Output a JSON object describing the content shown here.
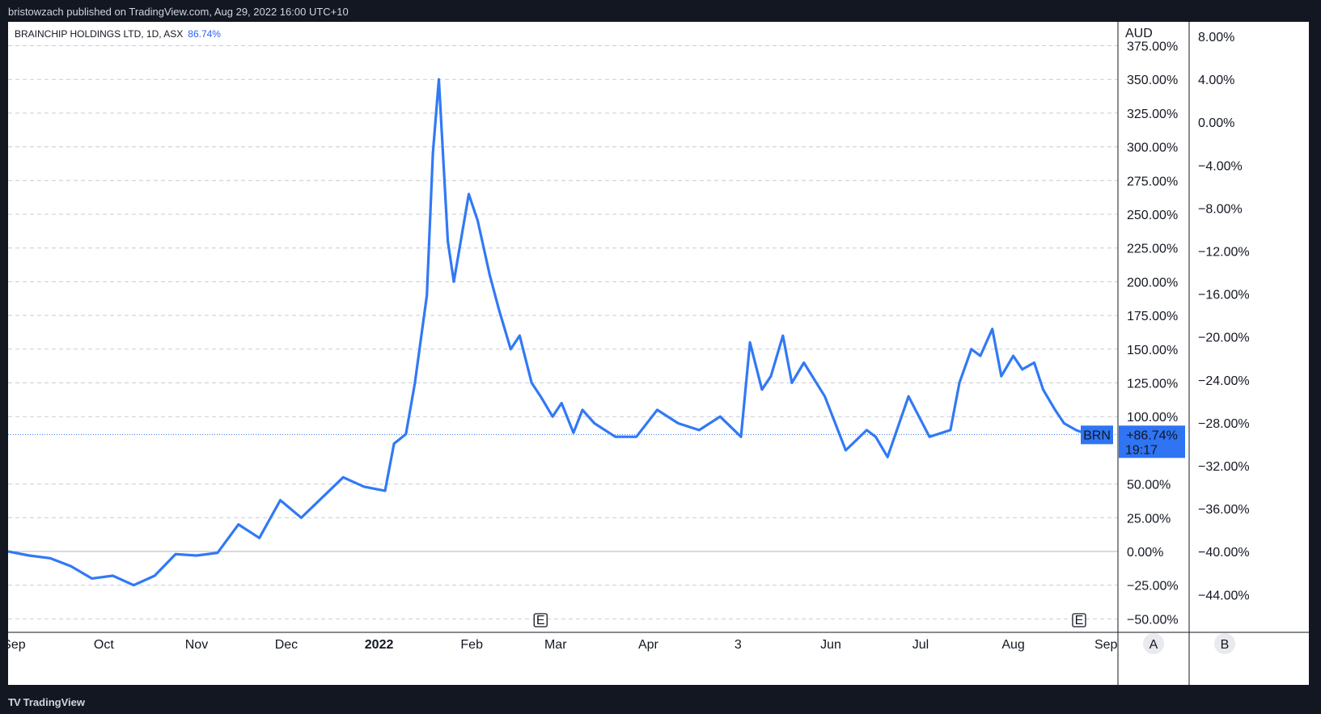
{
  "header": {
    "published_by": "bristowzach published on TradingView.com, Aug 29, 2022 16:00 UTC+10"
  },
  "legend": {
    "symbol_line": "BRAINCHIP HOLDINGS LTD, 1D, ASX",
    "change": "86.74%"
  },
  "scales": {
    "currency": "AUD"
  },
  "price_tag": {
    "symbol": "BRN",
    "value": "+86.74%",
    "countdown": "19:17"
  },
  "earnings_marker": {
    "label": "E"
  },
  "scale_buttons": [
    "A",
    "B"
  ],
  "footer": {
    "brand": "TradingView",
    "logo": "TV"
  },
  "colors": {
    "series": "#3179f5",
    "tag_bg": "#2f74f2",
    "grid": "#c9ccd3",
    "zero_line": "#b2b5be",
    "background": "#ffffff",
    "frame": "#131722"
  },
  "chart_data": {
    "type": "line",
    "series": [
      {
        "name": "BRN",
        "dates": [
          "2021-08-30",
          "2021-09-06",
          "2021-09-13",
          "2021-09-20",
          "2021-09-27",
          "2021-10-04",
          "2021-10-11",
          "2021-10-18",
          "2021-10-25",
          "2021-11-01",
          "2021-11-08",
          "2021-11-15",
          "2021-11-22",
          "2021-11-29",
          "2021-12-06",
          "2021-12-13",
          "2021-12-20",
          "2021-12-27",
          "2022-01-03",
          "2022-01-06",
          "2022-01-10",
          "2022-01-13",
          "2022-01-17",
          "2022-01-19",
          "2022-01-21",
          "2022-01-24",
          "2022-01-26",
          "2022-01-31",
          "2022-02-03",
          "2022-02-07",
          "2022-02-10",
          "2022-02-14",
          "2022-02-17",
          "2022-02-21",
          "2022-02-24",
          "2022-02-28",
          "2022-03-03",
          "2022-03-07",
          "2022-03-10",
          "2022-03-14",
          "2022-03-21",
          "2022-03-28",
          "2022-04-04",
          "2022-04-11",
          "2022-04-18",
          "2022-04-25",
          "2022-05-02",
          "2022-05-05",
          "2022-05-09",
          "2022-05-12",
          "2022-05-16",
          "2022-05-19",
          "2022-05-23",
          "2022-05-30",
          "2022-06-06",
          "2022-06-13",
          "2022-06-16",
          "2022-06-20",
          "2022-06-27",
          "2022-07-04",
          "2022-07-11",
          "2022-07-14",
          "2022-07-18",
          "2022-07-21",
          "2022-07-25",
          "2022-07-28",
          "2022-08-01",
          "2022-08-04",
          "2022-08-08",
          "2022-08-11",
          "2022-08-15",
          "2022-08-18",
          "2022-08-22",
          "2022-08-26"
        ],
        "values": [
          0,
          -3,
          -5,
          -11,
          -20,
          -18,
          -25,
          -18,
          -2,
          -3,
          -1,
          20,
          10,
          38,
          25,
          40,
          55,
          48,
          45,
          80,
          87,
          125,
          190,
          295,
          350,
          230,
          200,
          265,
          245,
          205,
          180,
          150,
          160,
          125,
          115,
          100,
          110,
          88,
          105,
          95,
          85,
          85,
          105,
          95,
          90,
          100,
          85,
          155,
          120,
          130,
          160,
          125,
          140,
          115,
          75,
          90,
          85,
          70,
          115,
          85,
          90,
          125,
          150,
          145,
          165,
          130,
          145,
          135,
          140,
          120,
          105,
          95,
          90,
          86.74
        ]
      }
    ],
    "y_ticks_left": [
      "375.00%",
      "350.00%",
      "325.00%",
      "300.00%",
      "275.00%",
      "250.00%",
      "225.00%",
      "200.00%",
      "175.00%",
      "150.00%",
      "125.00%",
      "100.00%",
      "50.00%",
      "25.00%",
      "0.00%",
      "−25.00%",
      "−50.00%"
    ],
    "y_ticks_right": [
      "8.00%",
      "4.00%",
      "0.00%",
      "−4.00%",
      "−8.00%",
      "−12.00%",
      "−16.00%",
      "−20.00%",
      "−24.00%",
      "−28.00%",
      "−32.00%",
      "−36.00%",
      "−40.00%",
      "−44.00%"
    ],
    "x_ticks": [
      "Sep",
      "Oct",
      "Nov",
      "Dec",
      "2022",
      "Feb",
      "Mar",
      "Apr",
      "3",
      "Jun",
      "Jul",
      "Aug",
      "Sep"
    ],
    "ylim": [
      -55,
      380
    ],
    "x_range": [
      "2021-08-30",
      "2022-09-05"
    ],
    "grid": true,
    "y_scale": "percent"
  }
}
